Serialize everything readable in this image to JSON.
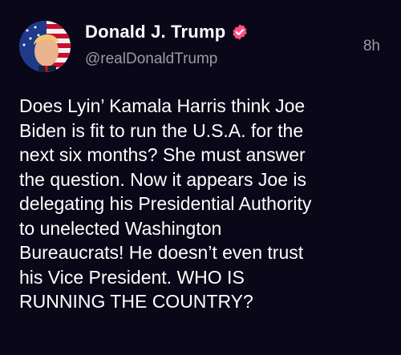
{
  "post": {
    "author": {
      "display_name": "Donald J. Trump",
      "handle": "@realDonaldTrump",
      "verified": true,
      "verified_badge_color": "#ff4f8a"
    },
    "timestamp": "8h",
    "body_lines": [
      "Does Lyin’ Kamala Harris think Joe",
      "Biden is fit to run the U.S.A. for the",
      "next six months? She must answer",
      "the question. Now it appears Joe is",
      "delegating his Presidential Authority",
      "to unelected Washington",
      "Bureaucrats! He doesn’t even trust",
      "his Vice President. WHO IS",
      "RUNNING THE COUNTRY?"
    ]
  },
  "theme": {
    "background": "#0a0718",
    "text_primary": "#ffffff",
    "text_secondary": "#9b99a6"
  }
}
